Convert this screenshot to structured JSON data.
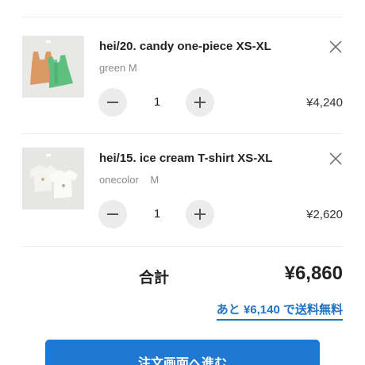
{
  "cart": {
    "items": [
      {
        "name": "hei/20. candy one-piece XS-XL",
        "variant": "green M",
        "quantity": "1",
        "price": "¥4,240",
        "image_icon": "dresses-product-photo",
        "colors": {
          "garment_1": "#d99a66",
          "garment_2": "#5dc07f"
        }
      },
      {
        "name": "hei/15. ice cream T-shirt XS-XL",
        "variant": "onecolor    M",
        "quantity": "1",
        "price": "¥2,620",
        "image_icon": "tshirts-product-photo",
        "colors": {
          "garment_1": "#f4f4f2",
          "garment_2": "#fafaf8"
        }
      }
    ],
    "controls": {
      "decrease_icon": "minus-icon",
      "increase_icon": "plus-icon",
      "remove_icon": "close-icon"
    }
  },
  "summary": {
    "total_label": "合計",
    "total_value": "¥6,860",
    "free_shipping_text": "あと ¥6,140 で送料無料"
  },
  "checkout": {
    "button_label": "注文画面へ進む"
  },
  "colors": {
    "accent": "#1f78d1",
    "link": "#1d73c8",
    "qty_button_bg": "#ececec",
    "text": "#222222",
    "muted": "#8a8a8a"
  }
}
